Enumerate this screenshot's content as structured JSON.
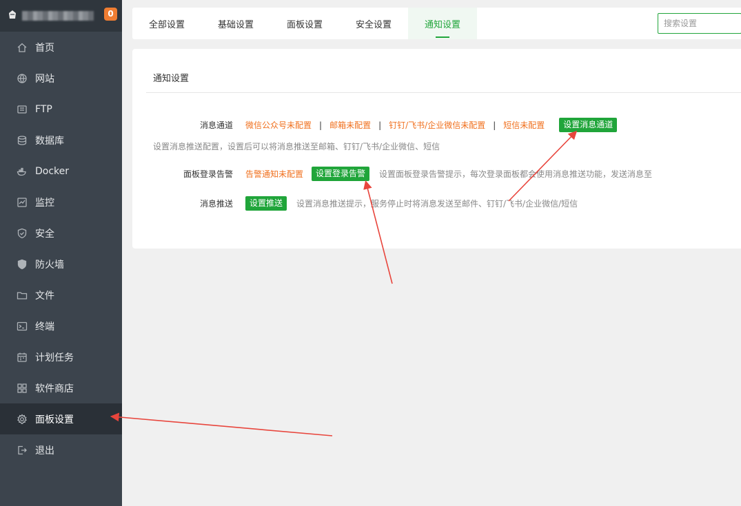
{
  "sidebar": {
    "badge": "0",
    "items": [
      {
        "label": "首页",
        "icon": "home-icon"
      },
      {
        "label": "网站",
        "icon": "globe-icon"
      },
      {
        "label": "FTP",
        "icon": "ftp-icon"
      },
      {
        "label": "数据库",
        "icon": "database-icon"
      },
      {
        "label": "Docker",
        "icon": "docker-icon"
      },
      {
        "label": "监控",
        "icon": "monitor-icon"
      },
      {
        "label": "安全",
        "icon": "shield-icon"
      },
      {
        "label": "防火墙",
        "icon": "firewall-icon"
      },
      {
        "label": "文件",
        "icon": "folder-icon"
      },
      {
        "label": "终端",
        "icon": "terminal-icon"
      },
      {
        "label": "计划任务",
        "icon": "calendar-icon"
      },
      {
        "label": "软件商店",
        "icon": "apps-icon"
      },
      {
        "label": "面板设置",
        "icon": "gear-icon",
        "active": true
      },
      {
        "label": "退出",
        "icon": "logout-icon"
      }
    ]
  },
  "tabs": [
    {
      "label": "全部设置"
    },
    {
      "label": "基础设置"
    },
    {
      "label": "面板设置"
    },
    {
      "label": "安全设置"
    },
    {
      "label": "通知设置",
      "active": true
    }
  ],
  "search": {
    "placeholder": "搜索设置",
    "value": ""
  },
  "card": {
    "title": "通知设置",
    "channel": {
      "label": "消息通道",
      "statuses": [
        "微信公众号未配置",
        "邮箱未配置",
        "钉钉/飞书/企业微信未配置",
        "短信未配置"
      ],
      "separator": "|",
      "button": "设置消息通道",
      "hint": "设置消息推送配置，设置后可以将消息推送至邮箱、钉钉/飞书/企业微信、短信"
    },
    "login_alert": {
      "label": "面板登录告警",
      "status": "告警通知未配置",
      "button": "设置登录告警",
      "hint": "设置面板登录告警提示，每次登录面板都会使用消息推送功能，发送消息至"
    },
    "push": {
      "label": "消息推送",
      "button": "设置推送",
      "hint": "设置消息推送提示，服务停止时将消息发送至邮件、钉钉/飞书/企业微信/短信"
    }
  },
  "colors": {
    "accent": "#20a53a",
    "warning": "#f0701e",
    "annotation": "#e8453c",
    "sidebar": "#3c444d"
  }
}
